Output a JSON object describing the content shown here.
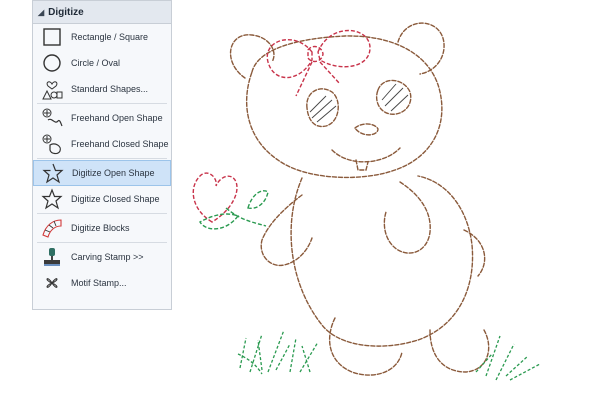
{
  "panel": {
    "title": "Digitize",
    "items": [
      {
        "label": "Rectangle / Square",
        "icon": "rectangle-icon"
      },
      {
        "label": "Circle / Oval",
        "icon": "circle-icon"
      },
      {
        "label": "Standard Shapes...",
        "icon": "standard-shapes-icon"
      },
      {
        "label": "Freehand Open Shape",
        "icon": "freehand-open-icon"
      },
      {
        "label": "Freehand Closed Shape",
        "icon": "freehand-closed-icon"
      },
      {
        "label": "Digitize Open Shape",
        "icon": "digitize-open-star-icon",
        "selected": true
      },
      {
        "label": "Digitize Closed Shape",
        "icon": "digitize-closed-star-icon"
      },
      {
        "label": "Digitize Blocks",
        "icon": "digitize-blocks-icon"
      },
      {
        "label": "Carving Stamp >>",
        "icon": "carving-stamp-icon"
      },
      {
        "label": "Motif Stamp...",
        "icon": "motif-stamp-icon"
      }
    ]
  },
  "colors": {
    "selected_bg": "#cfe3f8",
    "bear_stitch": "#8a5a3b",
    "bow_stitch": "#c8334a",
    "leaf_stitch": "#2a9a50",
    "icon_red": "#d23a3a"
  }
}
